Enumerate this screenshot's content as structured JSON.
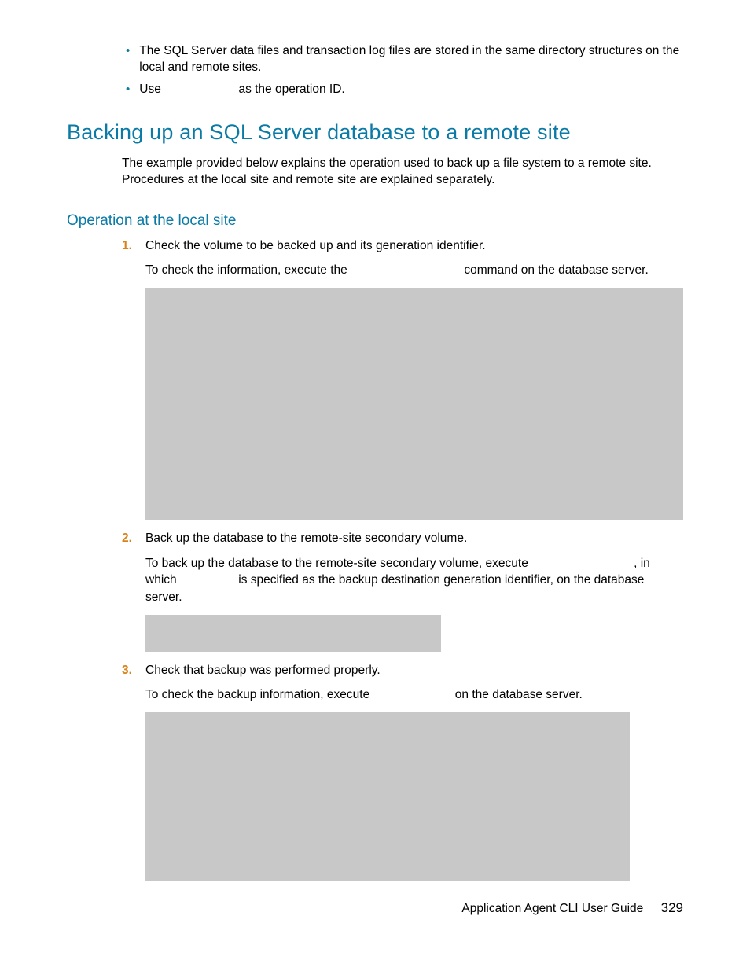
{
  "bullets": {
    "b1": "The SQL Server data files and transaction log files are stored in the same directory structures on the local and remote sites.",
    "b2a": "Use ",
    "b2b": " as the operation ID."
  },
  "heading1": "Backing up an SQL Server database to a remote site",
  "intro": "The example provided below explains the operation used to back up a file system to a remote site. Procedures at the local site and remote site are explained separately.",
  "heading2": "Operation at the local site",
  "steps": {
    "n1": "1.",
    "n2": "2.",
    "n3": "3.",
    "s1_title": "Check the volume to be backed up and its generation identifier.",
    "s1_sub_a": "To check the information, execute the ",
    "s1_sub_b": " command on the database server.",
    "s2_title": "Back up the database to the remote-site secondary volume.",
    "s2_sub_a": "To back up the database to the remote-site secondary volume, execute ",
    "s2_sub_b": ", in which ",
    "s2_sub_c": " is specified as the backup destination generation identifier, on the database server.",
    "s3_title": "Check that backup was performed properly.",
    "s3_sub_a": "To check the backup information, execute ",
    "s3_sub_b": " on the database server."
  },
  "footer": {
    "title": "Application Agent CLI User Guide",
    "page": "329"
  }
}
